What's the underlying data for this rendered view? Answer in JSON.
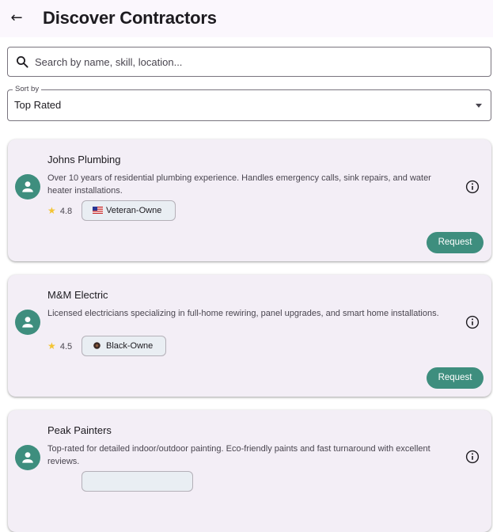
{
  "appbar": {
    "back_icon": "arrow-back-icon",
    "title": "Discover Contractors"
  },
  "search": {
    "icon": "search-icon",
    "placeholder": "Search by name, skill, location..."
  },
  "sort": {
    "label": "Sort by",
    "value": "Top Rated",
    "icon": "dropdown-arrow-icon"
  },
  "theme": {
    "accent": "#3e8e7e",
    "card_bg": "#f3eef6",
    "star": "#f3c433"
  },
  "contractors": [
    {
      "name": "Johns Plumbing",
      "description": "Over 10 years of residential plumbing experience. Handles emergency calls, sink repairs, and water heater installations.",
      "rating": "4.8",
      "badge": "Veteran-Owne",
      "badge_icon": "us-flag-icon",
      "action": "Request"
    },
    {
      "name": "M&M Electric",
      "description": "Licensed electricians specializing in full-home rewiring, panel upgrades, and smart home installations.",
      "rating": "4.5",
      "badge": "Black-Owne",
      "badge_icon": "black-owned-circle-icon",
      "action": "Request"
    },
    {
      "name": "Peak Painters",
      "description": "Top-rated for detailed indoor/outdoor painting. Eco-friendly paints and fast turnaround with excellent reviews."
    }
  ]
}
